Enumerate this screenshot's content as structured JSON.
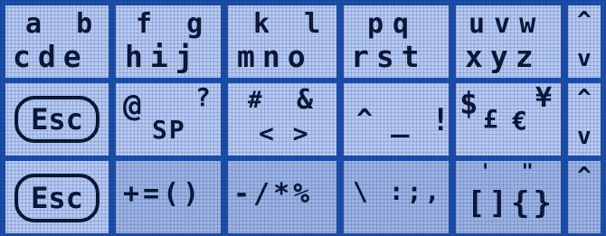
{
  "row1": {
    "keys": [
      {
        "top": "a b",
        "bottom": "cde"
      },
      {
        "top": "f g",
        "bottom": "hij"
      },
      {
        "top": "k l",
        "bottom": "mno"
      },
      {
        "top": "pq",
        "bottom": "rst"
      },
      {
        "top": "uvw",
        "bottom": "xyz"
      }
    ],
    "scroll": {
      "up": "^",
      "down": "v"
    }
  },
  "row2": {
    "esc": "Esc",
    "k2": {
      "main": "@",
      "sub": "SP",
      "sup": "?"
    },
    "k3": {
      "a": "#",
      "b": "&",
      "c": "< >"
    },
    "k4": {
      "a": "^",
      "b": "_ !"
    },
    "k5": {
      "a": "$",
      "b": "£",
      "c": "€",
      "d": "¥"
    },
    "scroll": {
      "up": "^",
      "down": "v"
    }
  },
  "row3": {
    "esc": "Esc",
    "k2": "+=()",
    "k3": "-/*%",
    "k4": "\\ :;,",
    "k5": {
      "quotes": "' \"",
      "brackets": "[]{}"
    },
    "scroll": {
      "up": "^"
    }
  }
}
